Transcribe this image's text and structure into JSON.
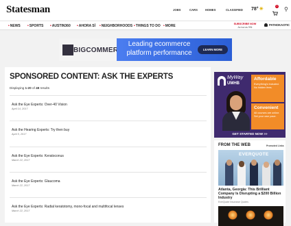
{
  "header": {
    "logo": "Statesman",
    "links": [
      "JOBS",
      "CARS",
      "HOMES",
      "CLASSIFIED"
    ],
    "temperature": "78°",
    "weather_icon": "sun-cloud-icon",
    "cart_count": "0"
  },
  "nav": {
    "items": [
      "NEWS",
      "SPORTS",
      "AUSTIN360",
      "AHORA SÍ",
      "NEIGHBORHOODS",
      "THINGS TO DO",
      "MORE"
    ],
    "subscribe_line1": "SUBSCRIBE NOW",
    "subscribe_line2": "As low as 99¢",
    "account": "PATHOKAOTIC"
  },
  "banner_ad": {
    "brand": "BIGCOMMERCE",
    "line1": "Leading ecommerce",
    "line2": "platform performance",
    "cta": "LEARN MORE"
  },
  "main": {
    "title": "SPONSORED CONTENT: ASK THE EXPERTS",
    "results_prefix": "Displaying ",
    "results_range": "1-20",
    "results_of": " of ",
    "results_total": "48",
    "results_suffix": " results",
    "articles": [
      {
        "title": "Ask the Eye Experts: Over-40 Vision",
        "date": "April 14, 2017"
      },
      {
        "title": "Ask the Hearing Experts: Try then buy",
        "date": "April 5, 2017"
      },
      {
        "title": "Ask the Eye Experts: Keratoconus",
        "date": "March 22, 2017"
      },
      {
        "title": "Ask the Eye Experts: Glaucoma",
        "date": "March 22, 2017"
      },
      {
        "title": "Ask the Eye Experts: Radial keratotomy, mono-focal and multifocal lenses",
        "date": "March 22, 2017"
      }
    ]
  },
  "sidebar_ad": {
    "brand_top": "MyWay",
    "brand_bottom": "UMHB",
    "box1_title": "Affordable",
    "box1_text": "Everything's included. No hidden fees.",
    "box2_title": "Convenient",
    "box2_text": "All courses are online. Set your own pace.",
    "cta": "GET STARTED NOW >>",
    "colors": {
      "purple": "#3f2a6e",
      "orange": "#f28c28"
    }
  },
  "from_the_web": {
    "title": "FROM THE WEB",
    "promoted": "Promoted Links",
    "image_brand": "EVERQUOTE",
    "headline": "Atlanta, Georgia: This Brilliant Company Is Disrupting a $200 Billion Industry",
    "source": "EverQuote Insurance Quotes"
  }
}
